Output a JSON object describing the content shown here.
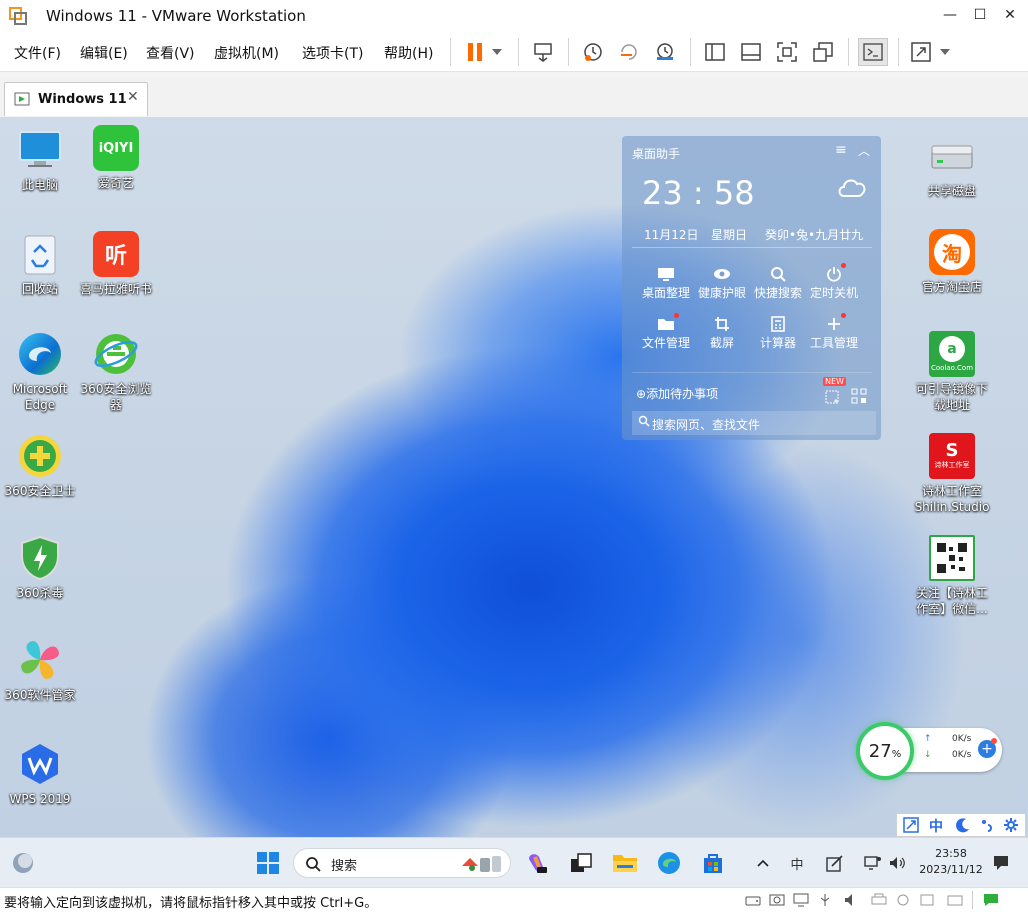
{
  "window": {
    "title": "Windows 11 - VMware Workstation",
    "minimize": "—",
    "maximize": "☐",
    "close": "✕"
  },
  "menu": {
    "items": [
      "文件(F)",
      "编辑(E)",
      "查看(V)",
      "虚拟机(M)",
      "选项卡(T)",
      "帮助(H)"
    ]
  },
  "tab": {
    "label": "Windows 11",
    "close": "✕"
  },
  "desktop": {
    "left_icons": [
      {
        "name": "this-pc",
        "label": "此电脑"
      },
      {
        "name": "iqiyi",
        "label": "爱奇艺",
        "logo": "iQIYI"
      },
      {
        "name": "recycle-bin",
        "label": "回收站"
      },
      {
        "name": "ximalaya",
        "label": "喜马拉雅听书",
        "logo": "听"
      },
      {
        "name": "edge",
        "label": "Microsoft Edge"
      },
      {
        "name": "360-browser",
        "label": "360安全浏览器"
      },
      {
        "name": "360-guard",
        "label": "360安全卫士"
      },
      {
        "name": "360-antivirus",
        "label": "360杀毒"
      },
      {
        "name": "360-software-manager",
        "label": "360软件管家"
      },
      {
        "name": "wps",
        "label": "WPS 2019"
      }
    ],
    "right_icons": [
      {
        "name": "shared-disk",
        "label": "共享磁盘"
      },
      {
        "name": "taobao",
        "label": "官方淘宝店",
        "logo": "淘"
      },
      {
        "name": "coolao",
        "label": "可引导镜像下载地址",
        "logo": "Coolao.Com"
      },
      {
        "name": "shilin-studio",
        "label": "诗林工作室 Shilin.Studio",
        "logo": "诗林工作室"
      },
      {
        "name": "wechat-qr",
        "label": "关注【诗林工作室】微信..."
      }
    ]
  },
  "widget": {
    "title": "桌面助手",
    "time": "23 : 58",
    "date": "11月12日",
    "weekday": "星期日",
    "lunar": "癸卯•兔•九月廿九",
    "tools": [
      "桌面整理",
      "健康护眼",
      "快捷搜索",
      "定时关机",
      "文件管理",
      "截屏",
      "计算器",
      "工具管理"
    ],
    "todo_label": "添加待办事项",
    "new_badge": "NEW",
    "search_placeholder": "搜索网页、查找文件"
  },
  "netspeed": {
    "percent": "27",
    "percent_sign": "%",
    "upload": "0K/s",
    "download": "0K/s",
    "up_arrow": "↑",
    "down_arrow": "↓"
  },
  "tray_popup": {
    "lang": "中"
  },
  "taskbar": {
    "search_label": "搜索",
    "ime": "中",
    "time": "23:58",
    "date": "2023/11/12"
  },
  "statusbar": {
    "message": "要将输入定向到该虚拟机，请将鼠标指针移入其中或按 Ctrl+G。"
  },
  "colors": {
    "accent_orange": "#ff6a00",
    "widget_bg": "rgba(110,150,200,0.55)",
    "taskbar_bg": "#e6edf5"
  }
}
